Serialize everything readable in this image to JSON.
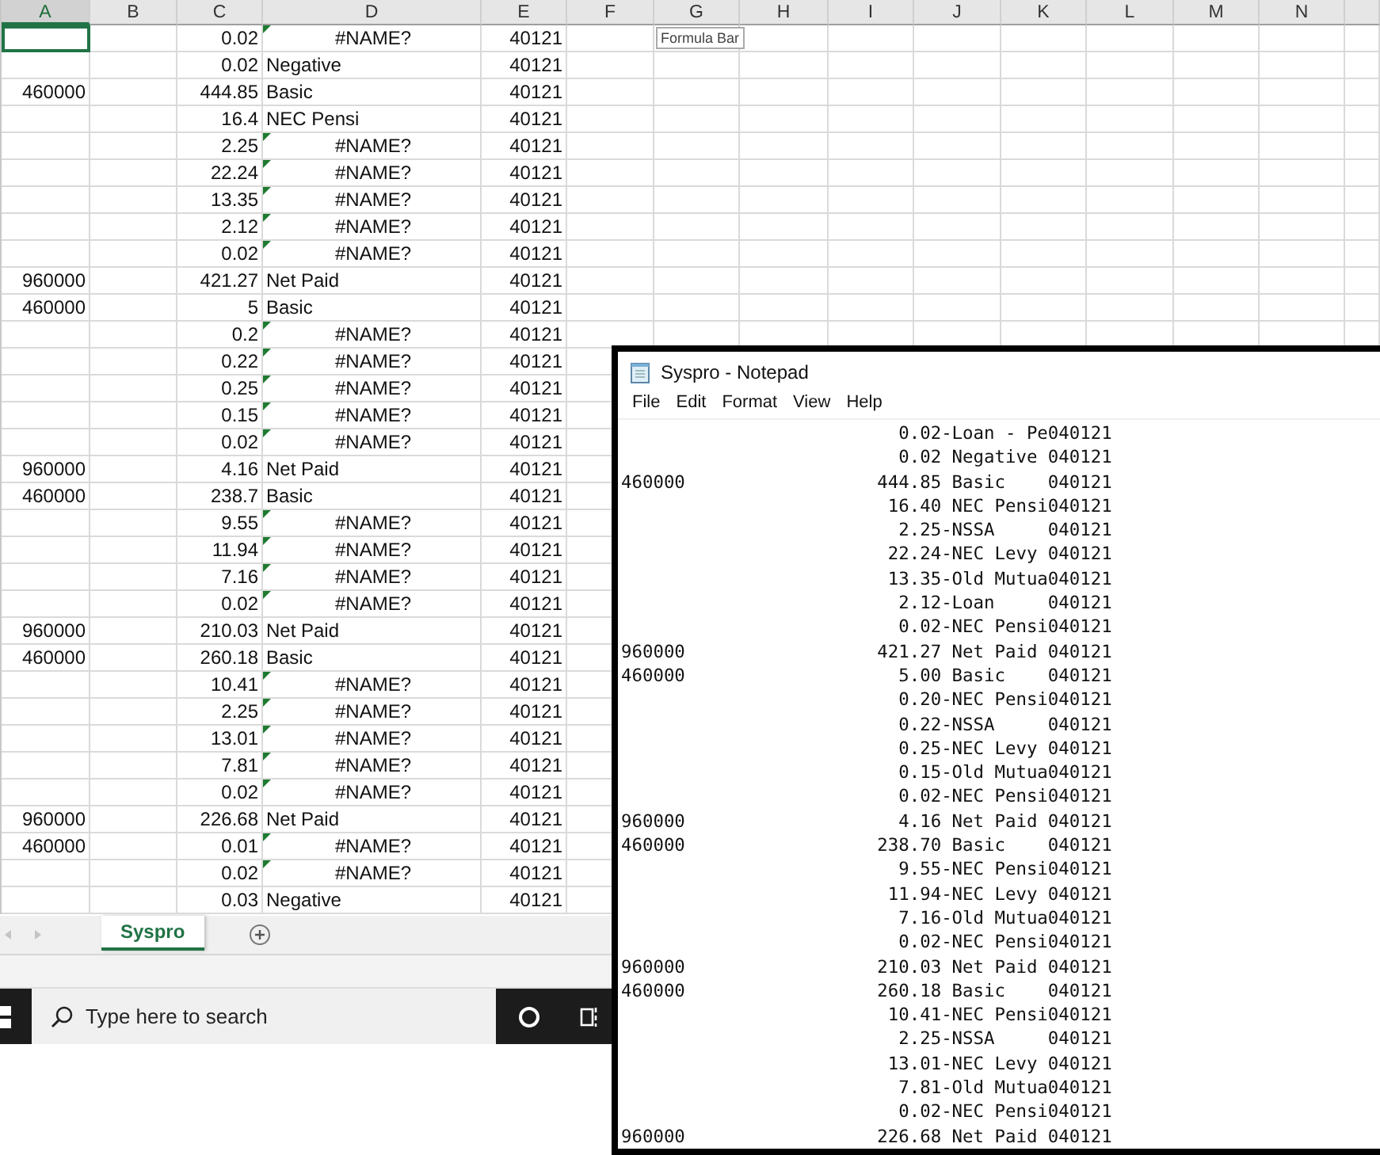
{
  "spreadsheet": {
    "tooltip": "Formula Bar",
    "columns": [
      {
        "label": "A",
        "selected": true
      },
      {
        "label": "B",
        "selected": false
      },
      {
        "label": "C",
        "selected": false
      },
      {
        "label": "D",
        "selected": false
      },
      {
        "label": "E",
        "selected": false
      },
      {
        "label": "F",
        "selected": false
      },
      {
        "label": "G",
        "selected": false
      },
      {
        "label": "H",
        "selected": false
      },
      {
        "label": "I",
        "selected": false
      },
      {
        "label": "J",
        "selected": false
      },
      {
        "label": "K",
        "selected": false
      },
      {
        "label": "L",
        "selected": false
      },
      {
        "label": "M",
        "selected": false
      },
      {
        "label": "N",
        "selected": false
      }
    ],
    "rows": [
      {
        "a_selected": true,
        "c": "0.02",
        "d": "#NAME?",
        "kind": "error",
        "e": "40121"
      },
      {
        "a_selected": false,
        "c": "0.02",
        "d": "Negative",
        "kind": "text",
        "e": "40121"
      },
      {
        "a_selected": false,
        "a": "460000",
        "c": "444.85",
        "d": "Basic",
        "kind": "text",
        "e": "40121"
      },
      {
        "a_selected": false,
        "c": "16.4",
        "d": "NEC Pensi",
        "kind": "text",
        "e": "40121"
      },
      {
        "a_selected": false,
        "c": "2.25",
        "d": "#NAME?",
        "kind": "error",
        "e": "40121"
      },
      {
        "a_selected": false,
        "c": "22.24",
        "d": "#NAME?",
        "kind": "error",
        "e": "40121"
      },
      {
        "a_selected": false,
        "c": "13.35",
        "d": "#NAME?",
        "kind": "error",
        "e": "40121"
      },
      {
        "a_selected": false,
        "c": "2.12",
        "d": "#NAME?",
        "kind": "error",
        "e": "40121"
      },
      {
        "a_selected": false,
        "c": "0.02",
        "d": "#NAME?",
        "kind": "error",
        "e": "40121"
      },
      {
        "a_selected": false,
        "a": "960000",
        "c": "421.27",
        "d": "Net Paid",
        "kind": "text",
        "e": "40121"
      },
      {
        "a_selected": false,
        "a": "460000",
        "c": "5",
        "d": "Basic",
        "kind": "text",
        "e": "40121"
      },
      {
        "a_selected": false,
        "c": "0.2",
        "d": "#NAME?",
        "kind": "error",
        "e": "40121"
      },
      {
        "a_selected": false,
        "c": "0.22",
        "d": "#NAME?",
        "kind": "error",
        "e": "40121"
      },
      {
        "a_selected": false,
        "c": "0.25",
        "d": "#NAME?",
        "kind": "error",
        "e": "40121"
      },
      {
        "a_selected": false,
        "c": "0.15",
        "d": "#NAME?",
        "kind": "error",
        "e": "40121"
      },
      {
        "a_selected": false,
        "c": "0.02",
        "d": "#NAME?",
        "kind": "error",
        "e": "40121"
      },
      {
        "a_selected": false,
        "a": "960000",
        "c": "4.16",
        "d": "Net Paid",
        "kind": "text",
        "e": "40121"
      },
      {
        "a_selected": false,
        "a": "460000",
        "c": "238.7",
        "d": "Basic",
        "kind": "text",
        "e": "40121"
      },
      {
        "a_selected": false,
        "c": "9.55",
        "d": "#NAME?",
        "kind": "error",
        "e": "40121"
      },
      {
        "a_selected": false,
        "c": "11.94",
        "d": "#NAME?",
        "kind": "error",
        "e": "40121"
      },
      {
        "a_selected": false,
        "c": "7.16",
        "d": "#NAME?",
        "kind": "error",
        "e": "40121"
      },
      {
        "a_selected": false,
        "c": "0.02",
        "d": "#NAME?",
        "kind": "error",
        "e": "40121"
      },
      {
        "a_selected": false,
        "a": "960000",
        "c": "210.03",
        "d": "Net Paid",
        "kind": "text",
        "e": "40121"
      },
      {
        "a_selected": false,
        "a": "460000",
        "c": "260.18",
        "d": "Basic",
        "kind": "text",
        "e": "40121"
      },
      {
        "a_selected": false,
        "c": "10.41",
        "d": "#NAME?",
        "kind": "error",
        "e": "40121"
      },
      {
        "a_selected": false,
        "c": "2.25",
        "d": "#NAME?",
        "kind": "error",
        "e": "40121"
      },
      {
        "a_selected": false,
        "c": "13.01",
        "d": "#NAME?",
        "kind": "error",
        "e": "40121"
      },
      {
        "a_selected": false,
        "c": "7.81",
        "d": "#NAME?",
        "kind": "error",
        "e": "40121"
      },
      {
        "a_selected": false,
        "c": "0.02",
        "d": "#NAME?",
        "kind": "error",
        "e": "40121"
      },
      {
        "a_selected": false,
        "a": "960000",
        "c": "226.68",
        "d": "Net Paid",
        "kind": "text",
        "e": "40121"
      },
      {
        "a_selected": false,
        "a": "460000",
        "c": "0.01",
        "d": "#NAME?",
        "kind": "error",
        "e": "40121"
      },
      {
        "a_selected": false,
        "c": "0.02",
        "d": "#NAME?",
        "kind": "error",
        "e": "40121"
      },
      {
        "a_selected": false,
        "c": "0.03",
        "d": "Negative",
        "kind": "text",
        "e": "40121"
      }
    ],
    "sheet_tabs": [
      {
        "label": "Syspro",
        "selected": true
      }
    ]
  },
  "taskbar": {
    "search": {
      "placeholder": "Type here to search"
    }
  },
  "notepad": {
    "title": "Syspro - Notepad",
    "menu": [
      "File",
      "Edit",
      "Format",
      "View",
      "Help"
    ],
    "lines": [
      "                          0.02-Loan - Pe040121",
      "                          0.02 Negative 040121",
      "460000                  444.85 Basic    040121",
      "                         16.40 NEC Pensi040121",
      "                          2.25-NSSA     040121",
      "                         22.24-NEC Levy 040121",
      "                         13.35-Old Mutua040121",
      "                          2.12-Loan     040121",
      "                          0.02-NEC Pensi040121",
      "960000                  421.27 Net Paid 040121",
      "460000                    5.00 Basic    040121",
      "                          0.20-NEC Pensi040121",
      "                          0.22-NSSA     040121",
      "                          0.25-NEC Levy 040121",
      "                          0.15-Old Mutua040121",
      "                          0.02-NEC Pensi040121",
      "960000                    4.16 Net Paid 040121",
      "460000                  238.70 Basic    040121",
      "                          9.55-NEC Pensi040121",
      "                         11.94-NEC Levy 040121",
      "                          7.16-Old Mutua040121",
      "                          0.02-NEC Pensi040121",
      "960000                  210.03 Net Paid 040121",
      "460000                  260.18 Basic    040121",
      "                         10.41-NEC Pensi040121",
      "                          2.25-NSSA     040121",
      "                         13.01-NEC Levy 040121",
      "                          7.81-Old Mutua040121",
      "                          0.02-NEC Pensi040121",
      "960000                  226.68 Net Paid 040121"
    ]
  }
}
